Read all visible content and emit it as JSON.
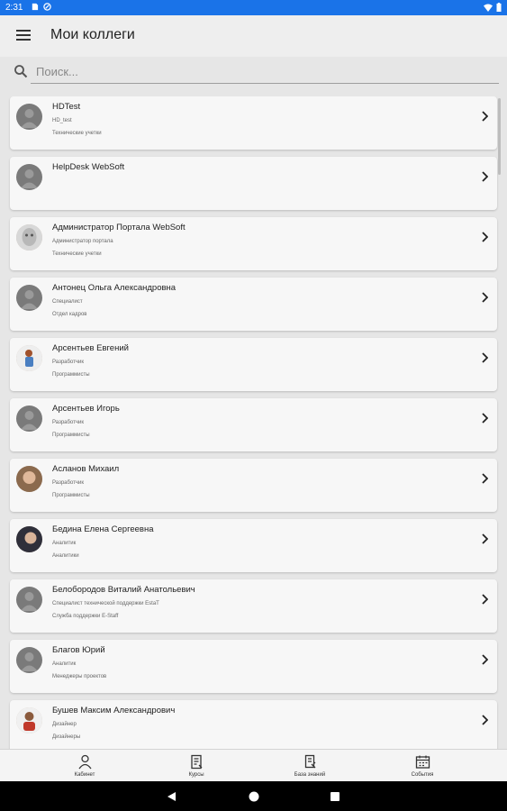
{
  "status_bar": {
    "time": "2:31"
  },
  "app_bar": {
    "title": "Мои коллеги",
    "menu_icon": "hamburger-menu-icon"
  },
  "search": {
    "placeholder": "Поиск...",
    "value": ""
  },
  "colleagues": [
    {
      "name": "HDTest",
      "position": "HD_test",
      "department": "Технические учетки",
      "avatar": "placeholder"
    },
    {
      "name": "HelpDesk WebSoft",
      "position": "",
      "department": "",
      "avatar": "placeholder"
    },
    {
      "name": "Администратор Портала WebSoft",
      "position": "Администратор портала",
      "department": "Технические учетки",
      "avatar": "photo"
    },
    {
      "name": "Антонец Ольга Александровна",
      "position": "Специалист",
      "department": "Отдел кадров",
      "avatar": "placeholder"
    },
    {
      "name": "Арсентьев Евгений",
      "position": "Разработчик",
      "department": "Программисты",
      "avatar": "photo"
    },
    {
      "name": "Арсентьев Игорь",
      "position": "Разработчик",
      "department": "Программисты",
      "avatar": "placeholder"
    },
    {
      "name": "Асланов Михаил",
      "position": "Разработчик",
      "department": "Программисты",
      "avatar": "photo"
    },
    {
      "name": "Бедина Елена Сергеевна",
      "position": "Аналитик",
      "department": "Аналитики",
      "avatar": "photo"
    },
    {
      "name": "Белобородов Виталий Анатольевич",
      "position": "Специалист технической поддержки EstaT",
      "department": "Служба поддержки E-Staff",
      "avatar": "placeholder"
    },
    {
      "name": "Благов Юрий",
      "position": "Аналитик",
      "department": "Менеджеры проектов",
      "avatar": "placeholder"
    },
    {
      "name": "Бушев Максим Александрович",
      "position": "Дизайнер",
      "department": "Дизайнеры",
      "avatar": "photo"
    }
  ],
  "bottom_nav": [
    {
      "label": "Кабинет",
      "icon": "person-icon"
    },
    {
      "label": "Курсы",
      "icon": "courses-icon"
    },
    {
      "label": "База знаний",
      "icon": "knowledge-base-icon"
    },
    {
      "label": "События",
      "icon": "calendar-icon"
    }
  ],
  "colors": {
    "status_bar": "#1a73e8",
    "app_bar": "#eeeeee",
    "background": "#e6e6e6",
    "card": "#f7f7f7"
  }
}
